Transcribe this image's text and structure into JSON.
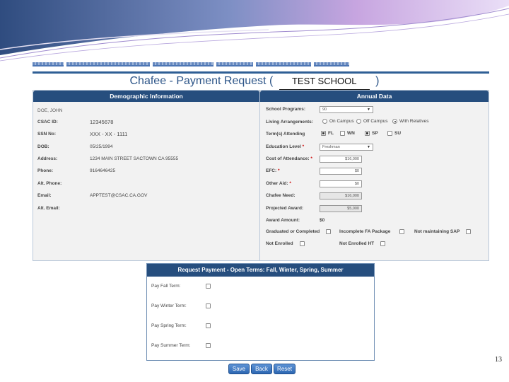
{
  "nav": {
    "links": [
      "",
      "",
      "",
      "",
      "",
      "",
      ""
    ]
  },
  "header": {
    "title_prefix": "Chafee - Payment Request (",
    "school": "TEST SCHOOL",
    "title_suffix": ")"
  },
  "demographic": {
    "heading": "Demographic Information",
    "name": "DOE, JOHN",
    "fields": [
      {
        "label": "CSAC ID:",
        "value": "12345678"
      },
      {
        "label": "SSN No:",
        "value": "XXX - XX - 1111"
      },
      {
        "label": "DOB:",
        "value": "05/25/1994"
      },
      {
        "label": "Address:",
        "value": "1234 MAIN STREET SACTOWN CA 95555"
      },
      {
        "label": "Phone:",
        "value": "9164646425"
      },
      {
        "label": "Alt. Phone:",
        "value": ""
      },
      {
        "label": "Email:",
        "value": "APPTEST@CSAC.CA.GOV"
      },
      {
        "label": "Alt. Email:",
        "value": ""
      }
    ]
  },
  "annual": {
    "heading": "Annual Data",
    "school_programs": {
      "label": "School Programs:",
      "value": "90"
    },
    "living": {
      "label": "Living Arrangements:",
      "options": [
        "On Campus",
        "Off Campus",
        "With Relatives"
      ],
      "selected": 2
    },
    "terms": {
      "label": "Term(s) Attending",
      "options": [
        {
          "name": "FL",
          "checked": true
        },
        {
          "name": "WN",
          "checked": false
        },
        {
          "name": "SP",
          "checked": true
        },
        {
          "name": "SU",
          "checked": false
        }
      ]
    },
    "education": {
      "label": "Education Level",
      "value": "Freshman"
    },
    "cost": {
      "label": "Cost of Attendance:",
      "value": "$16,000"
    },
    "efc": {
      "label": "EFC:",
      "value": "$0"
    },
    "other_aid": {
      "label": "Other Aid:",
      "value": "$0"
    },
    "need": {
      "label": "Chafee Need:",
      "value": "$16,000"
    },
    "projected": {
      "label": "Projected Award:",
      "value": "$5,000"
    },
    "award": {
      "label": "Award Amount:",
      "value": "$0"
    },
    "flags": {
      "graduated": "Graduated or Completed",
      "incomplete": "Incomplete FA Package",
      "sap": "Not maintaining SAP",
      "not_enrolled": "Not Enrolled",
      "not_enrolled_ht": "Not Enrolled HT"
    }
  },
  "payment": {
    "heading": "Request Payment - Open Terms: Fall, Winter, Spring, Summer",
    "terms": [
      "Pay Fall Term:",
      "Pay Winter Term:",
      "Pay Spring Term:",
      "Pay Summer Term:"
    ]
  },
  "buttons": {
    "save": "Save",
    "back": "Back",
    "reset": "Reset"
  },
  "page_number": "13"
}
